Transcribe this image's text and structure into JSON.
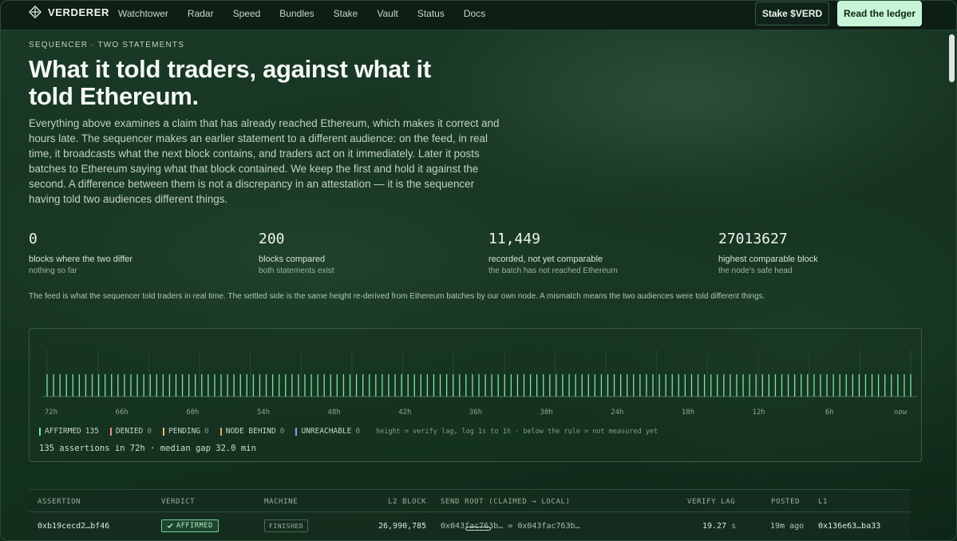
{
  "brand": {
    "name": "VERDERER"
  },
  "nav": {
    "links": [
      "Watchtower",
      "Radar",
      "Speed",
      "Bundles",
      "Stake",
      "Vault",
      "Status",
      "Docs"
    ],
    "stake_label": "Stake $VERD",
    "ledger_label": "Read the ledger"
  },
  "hero": {
    "eyebrow": "SEQUENCER · TWO STATEMENTS",
    "title": "What it told traders, against what it told Ethereum.",
    "body": "Everything above examines a claim that has already reached Ethereum, which makes it correct and hours late. The sequencer makes an earlier statement to a different audience: on the feed, in real time, it broadcasts what the next block contains, and traders act on it immediately. Later it posts batches to Ethereum saying what that block contained. We keep the first and hold it against the second. A difference between them is not a discrepancy in an attestation — it is the sequencer having told two audiences different things."
  },
  "stats": [
    {
      "value": "0",
      "label": "blocks where the two differ",
      "sub": "nothing so far"
    },
    {
      "value": "200",
      "label": "blocks compared",
      "sub": "both statements exist"
    },
    {
      "value": "11,449",
      "label": "recorded, not yet comparable",
      "sub": "the batch has not reached Ethereum"
    },
    {
      "value": "27013627",
      "label": "highest comparable block",
      "sub": "the node's safe head"
    }
  ],
  "note": "The feed is what the sequencer told traders in real time. The settled side is the same height re-derived from Ethereum batches by our own node. A mismatch means the two audiences were told different things.",
  "timeline": {
    "ticks": [
      "72h",
      "66h",
      "60h",
      "54h",
      "48h",
      "42h",
      "36h",
      "30h",
      "24h",
      "18h",
      "12h",
      "6h",
      "now"
    ],
    "legend": [
      {
        "label": "AFFIRMED",
        "count": "135",
        "color": "#7fe3a4"
      },
      {
        "label": "DENIED",
        "count": "0",
        "color": "#e88f7e"
      },
      {
        "label": "PENDING",
        "count": "0",
        "color": "#e8c07a"
      },
      {
        "label": "NODE BEHIND",
        "count": "0",
        "color": "#e3a86a"
      },
      {
        "label": "UNREACHABLE",
        "count": "0",
        "color": "#7fa8e3"
      }
    ],
    "hint": "height = verify lag, log 1s to 1h · below the rule = not measured yet",
    "summary": "135 assertions in 72h · median gap 32.0 min",
    "bar_count": 135
  },
  "table": {
    "headers": [
      "ASSERTION",
      "VERDICT",
      "MACHINE",
      "L2 BLOCK",
      "SEND ROOT (CLAIMED → LOCAL)",
      "VERIFY LAG",
      "POSTED",
      "L1"
    ],
    "rows": [
      {
        "assertion": "0xb19cecd2…bf46",
        "verdict": "AFFIRMED",
        "machine": "FINISHED",
        "l2_block": "26,990,785",
        "send_root": "0x043fac763b… = 0x043fac763b…",
        "verify_lag": "19.27",
        "verify_unit": "s",
        "posted": "19m ago",
        "l1": "0x136e63…ba33"
      }
    ]
  }
}
